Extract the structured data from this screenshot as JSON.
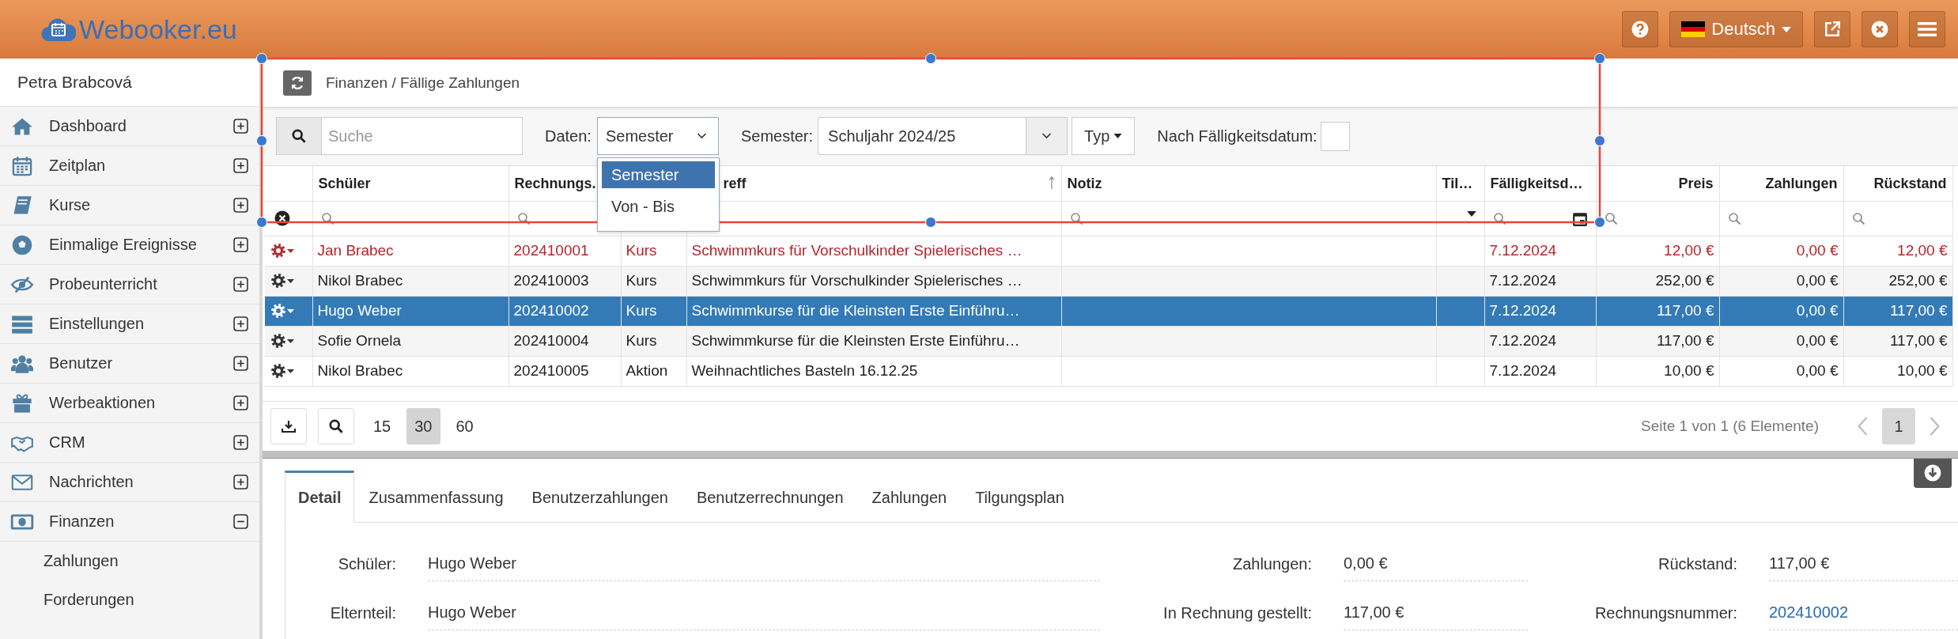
{
  "header": {
    "logo_text": "Webooker.eu",
    "language": "Deutsch"
  },
  "sidebar": {
    "user": "Petra Brabcová",
    "items": [
      {
        "label": "Dashboard",
        "expanded": false
      },
      {
        "label": "Zeitplan",
        "expanded": false
      },
      {
        "label": "Kurse",
        "expanded": false
      },
      {
        "label": "Einmalige Ereignisse",
        "expanded": false
      },
      {
        "label": "Probeunterricht",
        "expanded": false
      },
      {
        "label": "Einstellungen",
        "expanded": false
      },
      {
        "label": "Benutzer",
        "expanded": false
      },
      {
        "label": "Werbeaktionen",
        "expanded": false
      },
      {
        "label": "CRM",
        "expanded": false
      },
      {
        "label": "Nachrichten",
        "expanded": false
      },
      {
        "label": "Finanzen",
        "expanded": true,
        "children": [
          {
            "label": "Zahlungen"
          },
          {
            "label": "Forderungen"
          }
        ]
      }
    ]
  },
  "breadcrumb": "Finanzen / Fällige Zahlungen",
  "toolbar": {
    "search": {
      "placeholder": "Suche"
    },
    "data_label": "Daten:",
    "data_value": "Semester",
    "data_options": [
      {
        "label": "Semester",
        "selected": true
      },
      {
        "label": "Von - Bis",
        "selected": false
      }
    ],
    "semester_label": "Semester:",
    "semester_value": "Schuljahr 2024/25",
    "type_button": "Typ",
    "due_label": "Nach Fälligkeitsdatum:",
    "due_checked": false
  },
  "table": {
    "columns": [
      {
        "label": "Schüler",
        "kind": "text"
      },
      {
        "label": "Rechnungs.",
        "kind": "text"
      },
      {
        "kind": "plain"
      },
      {
        "label": "reff",
        "kind": "plain",
        "sorted": true
      },
      {
        "label": "Notiz",
        "kind": "text"
      },
      {
        "label": "Til…",
        "kind": "select"
      },
      {
        "label": "Fälligkeitsd…",
        "kind": "date"
      },
      {
        "label": "Preis",
        "kind": "money"
      },
      {
        "label": "Zahlungen",
        "kind": "money"
      },
      {
        "label": "Rückstand",
        "kind": "money"
      }
    ],
    "rows": [
      {
        "overdue": true,
        "selected": false,
        "cells": [
          "Jan Brabec",
          "202410001",
          "Kurs",
          "Schwimmkurs für Vorschulkinder Spielerisches …",
          null,
          null,
          "7.12.2024",
          "12,00 €",
          "0,00 €",
          "12,00 €"
        ]
      },
      {
        "overdue": false,
        "selected": false,
        "cells": [
          "Nikol Brabec",
          "202410003",
          "Kurs",
          "Schwimmkurs für Vorschulkinder Spielerisches …",
          null,
          null,
          "7.12.2024",
          "252,00 €",
          "0,00 €",
          "252,00 €"
        ]
      },
      {
        "overdue": false,
        "selected": true,
        "cells": [
          "Hugo Weber",
          "202410002",
          "Kurs",
          "Schwimmkurse für die Kleinsten Erste Einführu…",
          null,
          null,
          "7.12.2024",
          "117,00 €",
          "0,00 €",
          "117,00 €"
        ]
      },
      {
        "overdue": false,
        "selected": false,
        "cells": [
          "Sofie Ornela",
          "202410004",
          "Kurs",
          "Schwimmkurse für die Kleinsten Erste Einführu…",
          null,
          null,
          "7.12.2024",
          "117,00 €",
          "0,00 €",
          "117,00 €"
        ]
      },
      {
        "overdue": false,
        "selected": false,
        "cells": [
          "Nikol Brabec",
          "202410005",
          "Aktion",
          "Weihnachtliches Basteln 16.12.25",
          null,
          null,
          "7.12.2024",
          "10,00 €",
          "0,00 €",
          "10,00 €"
        ]
      }
    ]
  },
  "pager": {
    "sizes": [
      {
        "label": "15",
        "selected": false
      },
      {
        "label": "30",
        "selected": true
      },
      {
        "label": "60",
        "selected": false
      }
    ],
    "info": "Seite 1 von 1 (6 Elemente)",
    "pages": [
      {
        "label": "1",
        "selected": true
      }
    ]
  },
  "detail": {
    "tabs": [
      {
        "label": "Detail",
        "selected": true
      },
      {
        "label": "Zusammenfassung",
        "selected": false
      },
      {
        "label": "Benutzerzahlungen",
        "selected": false
      },
      {
        "label": "Benutzerrechnungen",
        "selected": false
      },
      {
        "label": "Zahlungen",
        "selected": false
      },
      {
        "label": "Tilgungsplan",
        "selected": false
      }
    ],
    "fields": [
      {
        "label": "Schüler:",
        "value": "Hugo Weber",
        "kind": "text"
      },
      {
        "label": "Zahlungen:",
        "value": "0,00 €",
        "kind": "text"
      },
      {
        "label": "Rückstand:",
        "value": "117,00 €",
        "kind": "text"
      },
      {
        "label": "Elternteil:",
        "value": "Hugo Weber",
        "kind": "text"
      },
      {
        "label": "In Rechnung gestellt:",
        "value": "117,00 €",
        "kind": "text"
      },
      {
        "label": "Rechnungsnummer:",
        "value": "202410002",
        "kind": "link"
      }
    ]
  }
}
